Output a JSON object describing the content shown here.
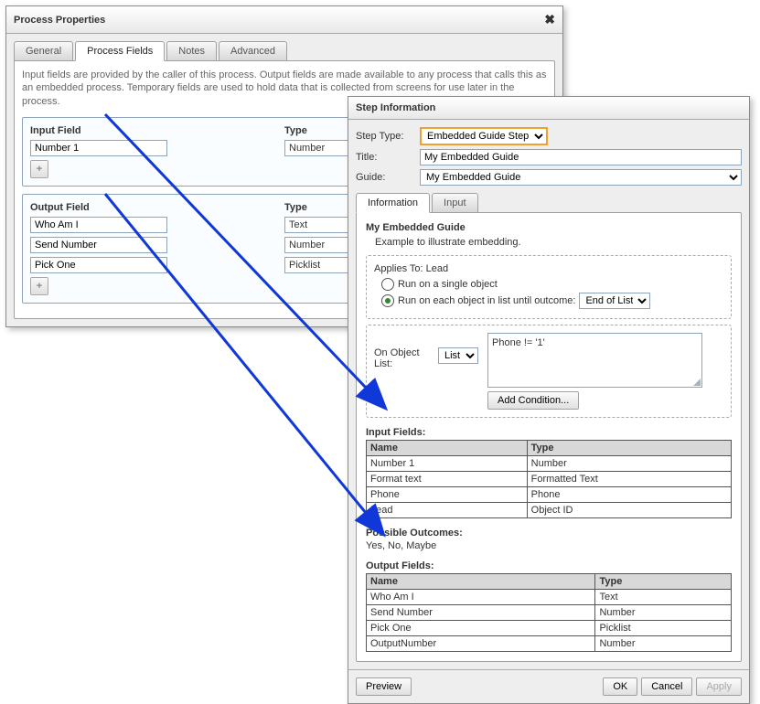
{
  "process_props": {
    "title": "Process Properties",
    "tabs": {
      "general": "General",
      "process_fields": "Process Fields",
      "notes": "Notes",
      "advanced": "Advanced"
    },
    "desc": "Input fields are provided by the caller of this process. Output fields are made available to any process that calls this as an embedded process. Temporary fields are used to hold data that is collected from screens for use later in the process.",
    "input_head": "Input Field",
    "type_head": "Type",
    "output_head": "Output Field",
    "inputs": [
      {
        "name": "Number 1",
        "type": "Number"
      }
    ],
    "outputs": [
      {
        "name": "Who Am I",
        "type": "Text"
      },
      {
        "name": "Send Number",
        "type": "Number"
      },
      {
        "name": "Pick One",
        "type": "Picklist"
      }
    ]
  },
  "step_info": {
    "title_bar": "Step Information",
    "step_type_label": "Step Type:",
    "step_type_value": "Embedded Guide Step",
    "title_label": "Title:",
    "title_value": "My Embedded Guide",
    "guide_label": "Guide:",
    "guide_value": "My Embedded Guide",
    "tab_info": "Information",
    "tab_input": "Input",
    "guide_name": "My Embedded Guide",
    "guide_desc": "Example to illustrate embedding.",
    "applies_label": "Applies To: Lead",
    "radio_single": "Run on a single object",
    "radio_each": "Run on each object in list until outcome:",
    "outcome_value": "End of List",
    "on_object_label": "On Object List:",
    "on_object_value": "List",
    "condition_text": "Phone != '1'",
    "add_condition": "Add Condition...",
    "input_fields_title": "Input Fields:",
    "output_fields_title": "Output Fields:",
    "possible_outcomes_title": "Possible Outcomes:",
    "possible_outcomes_value": "Yes, No, Maybe",
    "col_name": "Name",
    "col_type": "Type",
    "input_fields": [
      {
        "name": "Number 1",
        "type": "Number"
      },
      {
        "name": "Format text",
        "type": "Formatted Text"
      },
      {
        "name": "Phone",
        "type": "Phone"
      },
      {
        "name": "Lead",
        "type": "Object ID"
      }
    ],
    "output_fields": [
      {
        "name": "Who Am I",
        "type": "Text"
      },
      {
        "name": "Send Number",
        "type": "Number"
      },
      {
        "name": "Pick One",
        "type": "Picklist"
      },
      {
        "name": "OutputNumber",
        "type": "Number"
      }
    ],
    "preview": "Preview",
    "ok": "OK",
    "cancel": "Cancel",
    "apply": "Apply"
  },
  "glyphs": {
    "plus": "+",
    "close": "✖",
    "dropdown": "▾"
  }
}
